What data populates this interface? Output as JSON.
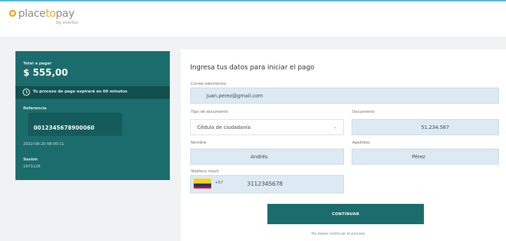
{
  "brand": {
    "name_part1": "place",
    "name_part2": "to",
    "name_part3": "pay",
    "sub": "by evertec"
  },
  "summary": {
    "total_label": "Total a pagar",
    "total_value": "$ 555,00",
    "expire_text": "Tu proceso de pago expirará en 00 minutos",
    "reference_label": "Referencia",
    "reference_value": "0012345678900060",
    "date": "2022-08-20 08:00:11",
    "session_label": "Sesión",
    "session_value": "1971126"
  },
  "form": {
    "title": "Ingresa tus datos para iniciar el pago",
    "email_label": "Correo electrónico",
    "email_value": "juan.perez@gmail.com",
    "doctype_label": "Tipo de documento",
    "doctype_value": "Cédula de ciudadanía",
    "document_label": "Documento",
    "document_value": "51.234.567",
    "name_label": "Nombre",
    "name_value": "Andrés",
    "surname_label": "Apellidos",
    "surname_value": "Pérez",
    "phone_label": "Teléfono móvil",
    "phone_code": "+57",
    "phone_value": "3112345678",
    "continue_label": "CONTINUAR",
    "cancel_link": "No deseo continuar el proceso"
  },
  "colors": {
    "primary": "#1b6c6c",
    "primary_dark": "#11504f",
    "accent_orange": "#f5a623",
    "filled_field": "#dde9f3"
  }
}
